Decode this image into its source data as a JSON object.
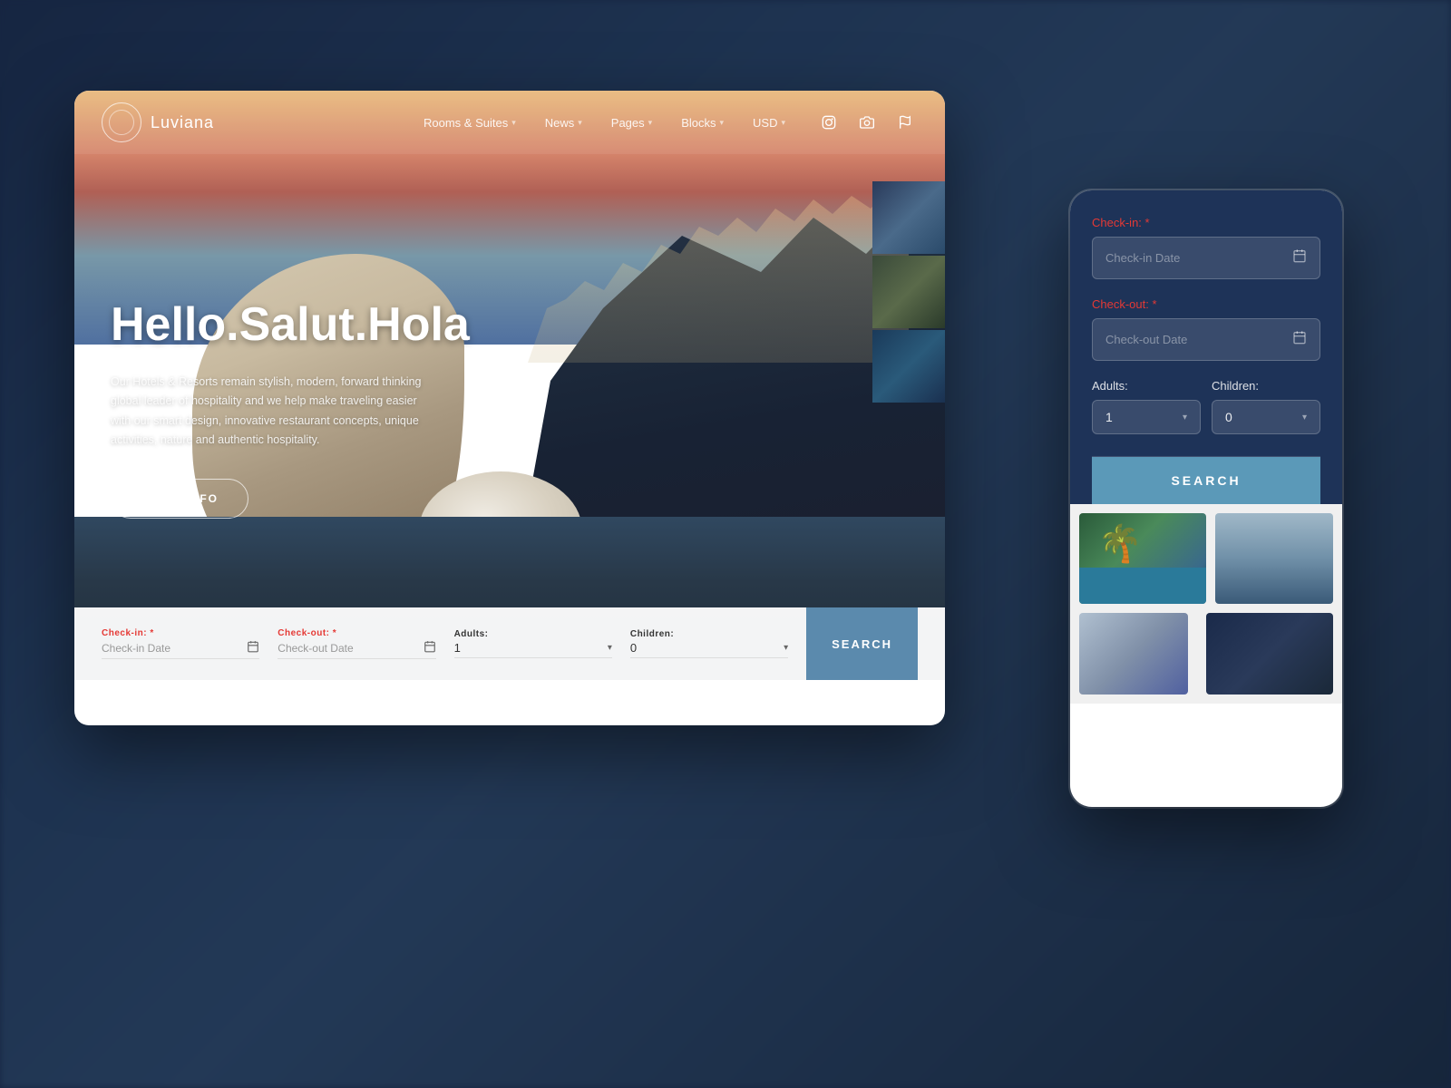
{
  "background": {
    "color": "#1a2a4a"
  },
  "site": {
    "logo_text": "Luviana",
    "logo_icon": "circle-ornament"
  },
  "navbar": {
    "items": [
      {
        "label": "Rooms & Suites",
        "has_dropdown": true
      },
      {
        "label": "News",
        "has_dropdown": true
      },
      {
        "label": "Pages",
        "has_dropdown": true
      },
      {
        "label": "Blocks",
        "has_dropdown": true
      },
      {
        "label": "USD",
        "has_dropdown": true
      }
    ],
    "icons": [
      {
        "name": "instagram-icon",
        "symbol": "📷"
      },
      {
        "name": "camera-icon",
        "symbol": "📸"
      },
      {
        "name": "flag-icon",
        "symbol": "⚑"
      }
    ]
  },
  "hero": {
    "title": "Hello.Salut.Hola",
    "subtitle": "Our Hotels & Resorts remain stylish, modern, forward thinking global leader of hospitality and we help make traveling easier with our smart design, innovative restaurant concepts, unique activities, nature and authentic hospitality.",
    "cta_label": "MORE INFO",
    "dots": [
      {
        "active": true
      },
      {
        "active": false
      },
      {
        "active": false
      },
      {
        "active": false
      },
      {
        "active": false
      }
    ]
  },
  "booking_bar": {
    "checkin_label": "Check-in:",
    "checkin_required": "*",
    "checkin_placeholder": "Check-in Date",
    "checkout_label": "Check-out:",
    "checkout_required": "*",
    "checkout_placeholder": "Check-out Date",
    "adults_label": "Adults:",
    "adults_value": "1",
    "children_label": "Children:",
    "children_value": "0",
    "search_label": "SEARCH"
  },
  "mobile_booking": {
    "checkin_label": "Check-in:",
    "checkin_required": "*",
    "checkin_placeholder": "Check-in Date",
    "checkout_label": "Check-out:",
    "checkout_required": "*",
    "checkout_placeholder": "Check-out Date",
    "adults_label": "Adults:",
    "adults_value": "1",
    "children_label": "Children:",
    "children_value": "0",
    "search_label": "SEARCH"
  },
  "colors": {
    "nav_bg": "rgba(255,255,255,0.08)",
    "booking_form_bg": "#1e3358",
    "search_btn": "#5b99b8",
    "accent": "#5b8aad"
  }
}
